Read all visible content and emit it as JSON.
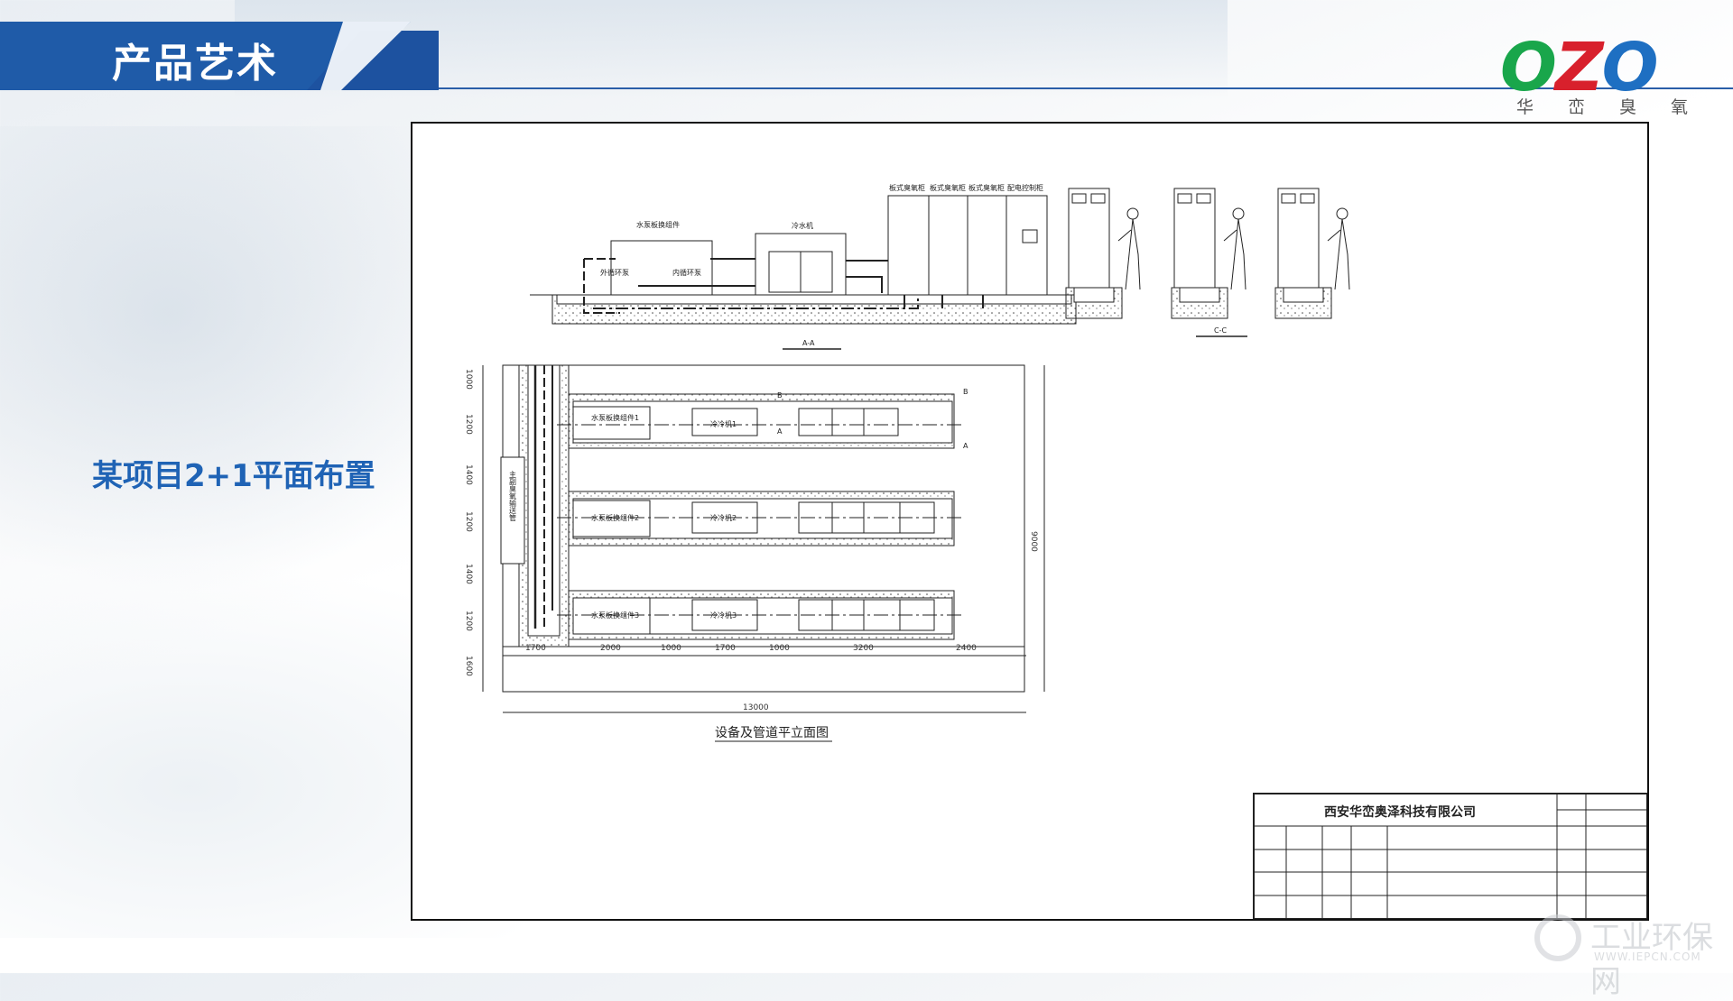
{
  "header": {
    "title": "产品艺术"
  },
  "logo": {
    "letters": [
      "O",
      "Z",
      "O"
    ],
    "subtitle_chars": [
      "华",
      "峦",
      "臭",
      "氧"
    ]
  },
  "section": {
    "label": "某项目2+1平面布置"
  },
  "drawing": {
    "section_aa": {
      "labels": [
        "水泵板换组件",
        "外循环泵",
        "内循环泵",
        "冷水机",
        "板式臭氧柜",
        "板式臭氧柜",
        "板式臭氧柜",
        "配电控制柜"
      ],
      "caption": "A-A"
    },
    "section_cc": {
      "caption": "C-C"
    },
    "plan": {
      "rows": [
        {
          "module": "水泵板换组件1",
          "chiller": "冷冷机1"
        },
        {
          "module": "水泵板换组件2",
          "chiller": "冷冷机2"
        },
        {
          "module": "水泵板换组件3",
          "chiller": "冷冷机3"
        }
      ],
      "side_label": "主副臭氧输送管",
      "bottom_dims": [
        "1700",
        "2000",
        "1000",
        "1700",
        "1000",
        "3200",
        "2400"
      ],
      "left_dims": [
        "1000",
        "1200",
        "1400",
        "1200",
        "1400",
        "1200",
        "1600"
      ],
      "right_dim": "9000",
      "total_dim": "13000",
      "marks": [
        "A",
        "A",
        "B",
        "B"
      ],
      "caption": "设备及管道平立面图"
    },
    "title_block": {
      "company": "西安华峦奥泽科技有限公司"
    }
  },
  "watermark": {
    "text": "工业环保网",
    "url": "WWW.IEPCN.COM"
  },
  "colors": {
    "primary_blue": "#1f5ba8",
    "title_text": "#ffffff",
    "label_blue": "#1f63b5",
    "logo_green": "#19a64b",
    "logo_red": "#d8202c",
    "logo_blue": "#1e6fc2"
  }
}
